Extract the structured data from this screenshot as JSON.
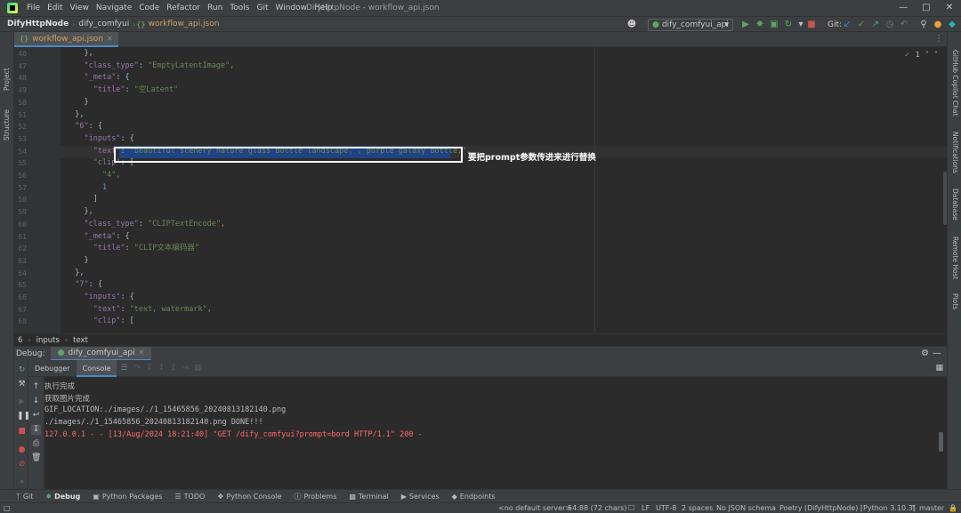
{
  "menu": [
    "File",
    "Edit",
    "View",
    "Navigate",
    "Code",
    "Refactor",
    "Run",
    "Tools",
    "Git",
    "Window",
    "Help"
  ],
  "window_title": "DifyHttpNode - workflow_api.json",
  "nav": {
    "project": "DifyHttpNode",
    "folder": "dify_comfyui",
    "file": "workflow_api.json",
    "run_config": "dify_comfyui_api",
    "git_label": "Git:"
  },
  "left_strip": [
    "Project",
    "Structure"
  ],
  "right_strip": [
    "GitHub Copilot Chat",
    "Notifications",
    "Database",
    "Remote Host",
    "Plots"
  ],
  "editor_tab": "workflow_api.json",
  "inspection": {
    "count": "1"
  },
  "code": {
    "line_numbers": [
      "46",
      "47",
      "48",
      "49",
      "50",
      "51",
      "52",
      "53",
      "54",
      "55",
      "56",
      "57",
      "58",
      "59",
      "60",
      "61",
      "62",
      "63",
      "64",
      "65",
      "66",
      "67",
      "68"
    ],
    "lines": [
      [
        {
          "t": "    },",
          "c": "p"
        }
      ],
      [
        {
          "t": "    ",
          "c": "p"
        },
        {
          "t": "\"class_type\"",
          "c": "k"
        },
        {
          "t": ": ",
          "c": "p"
        },
        {
          "t": "\"EmptyLatentImage\"",
          "c": "s"
        },
        {
          "t": ",",
          "c": "o"
        }
      ],
      [
        {
          "t": "    ",
          "c": "p"
        },
        {
          "t": "\"_meta\"",
          "c": "k"
        },
        {
          "t": ": {",
          "c": "p"
        }
      ],
      [
        {
          "t": "      ",
          "c": "p"
        },
        {
          "t": "\"title\"",
          "c": "k"
        },
        {
          "t": ": ",
          "c": "p"
        },
        {
          "t": "\"空Latent\"",
          "c": "s"
        }
      ],
      [
        {
          "t": "    }",
          "c": "p"
        }
      ],
      [
        {
          "t": "  },",
          "c": "p"
        }
      ],
      [
        {
          "t": "  ",
          "c": "p"
        },
        {
          "t": "\"6\"",
          "c": "k"
        },
        {
          "t": ": {",
          "c": "p"
        }
      ],
      [
        {
          "t": "    ",
          "c": "p"
        },
        {
          "t": "\"inputs\"",
          "c": "k"
        },
        {
          "t": ": {",
          "c": "p"
        }
      ],
      [
        {
          "t": "      ",
          "c": "p"
        },
        {
          "t": "\"text\"",
          "c": "k"
        },
        {
          "t": ": ",
          "c": "p"
        },
        {
          "t": "\"beautiful scenery nature glass bottle landscape, , purple galaxy bottle,\"",
          "c": "s"
        },
        {
          "t": ",",
          "c": "o"
        }
      ],
      [
        {
          "t": "      ",
          "c": "p"
        },
        {
          "t": "\"clip\"",
          "c": "k"
        },
        {
          "t": ": [",
          "c": "p"
        }
      ],
      [
        {
          "t": "        ",
          "c": "p"
        },
        {
          "t": "\"4\"",
          "c": "s"
        },
        {
          "t": ",",
          "c": "o"
        }
      ],
      [
        {
          "t": "        ",
          "c": "p"
        },
        {
          "t": "1",
          "c": "n"
        }
      ],
      [
        {
          "t": "      ]",
          "c": "p"
        }
      ],
      [
        {
          "t": "    },",
          "c": "p"
        }
      ],
      [
        {
          "t": "    ",
          "c": "p"
        },
        {
          "t": "\"class_type\"",
          "c": "k"
        },
        {
          "t": ": ",
          "c": "p"
        },
        {
          "t": "\"CLIPTextEncode\"",
          "c": "s"
        },
        {
          "t": ",",
          "c": "o"
        }
      ],
      [
        {
          "t": "    ",
          "c": "p"
        },
        {
          "t": "\"_meta\"",
          "c": "k"
        },
        {
          "t": ": {",
          "c": "p"
        }
      ],
      [
        {
          "t": "      ",
          "c": "p"
        },
        {
          "t": "\"title\"",
          "c": "k"
        },
        {
          "t": ": ",
          "c": "p"
        },
        {
          "t": "\"CLIP文本编码器\"",
          "c": "s"
        }
      ],
      [
        {
          "t": "    }",
          "c": "p"
        }
      ],
      [
        {
          "t": "  },",
          "c": "p"
        }
      ],
      [
        {
          "t": "  ",
          "c": "p"
        },
        {
          "t": "\"7\"",
          "c": "k"
        },
        {
          "t": ": {",
          "c": "p"
        }
      ],
      [
        {
          "t": "    ",
          "c": "p"
        },
        {
          "t": "\"inputs\"",
          "c": "k"
        },
        {
          "t": ": {",
          "c": "p"
        }
      ],
      [
        {
          "t": "      ",
          "c": "p"
        },
        {
          "t": "\"text\"",
          "c": "k"
        },
        {
          "t": ": ",
          "c": "p"
        },
        {
          "t": "\"text, watermark\"",
          "c": "s"
        },
        {
          "t": ",",
          "c": "o"
        }
      ],
      [
        {
          "t": "      ",
          "c": "p"
        },
        {
          "t": "\"clip\"",
          "c": "k"
        },
        {
          "t": ": [",
          "c": "p"
        }
      ]
    ]
  },
  "annotation": "要把prompt参数传进来进行替换",
  "breadcrumb": [
    "6",
    "inputs",
    "text"
  ],
  "debug": {
    "label": "Debug:",
    "session": "dify_comfyui_api",
    "tabs": [
      "Debugger",
      "Console"
    ]
  },
  "console": [
    {
      "text": "执行完成",
      "err": false
    },
    {
      "text": "获取图片完成",
      "err": false
    },
    {
      "text": "GIF_LOCATION:./images/./1_15465856_20240813182140.png",
      "err": false
    },
    {
      "text": "./images/./1_15465856_20240813182140.png DONE!!!",
      "err": false
    },
    {
      "text": "127.0.0.1 - - [13/Aug/2024 18:21:40] \"GET /dify_comfyui?prompt=bord HTTP/1.1\" 200 -",
      "err": true
    }
  ],
  "bottom_tools": [
    {
      "label": "Git",
      "icon": "git-icon"
    },
    {
      "label": "Debug",
      "icon": "debug-icon",
      "active": true
    },
    {
      "label": "Python Packages",
      "icon": "packages-icon"
    },
    {
      "label": "TODO",
      "icon": "todo-icon"
    },
    {
      "label": "Python Console",
      "icon": "python-console-icon"
    },
    {
      "label": "Problems",
      "icon": "problems-icon"
    },
    {
      "label": "Terminal",
      "icon": "terminal-icon"
    },
    {
      "label": "Services",
      "icon": "services-icon"
    },
    {
      "label": "Endpoints",
      "icon": "endpoints-icon"
    }
  ],
  "status": {
    "server": "<no default server>",
    "position": "54:88 (72 chars)",
    "line_sep": "LF",
    "encoding": "UTF-8",
    "indent": "2 spaces",
    "schema": "No JSON schema",
    "interpreter": "Poetry (DifyHttpNode) [Python 3.10.3]",
    "branch": "master"
  },
  "colors": {
    "accent": "#4a88c7",
    "run_green": "#59a869",
    "stop_red": "#c75450",
    "error_text": "#ff6b68"
  }
}
